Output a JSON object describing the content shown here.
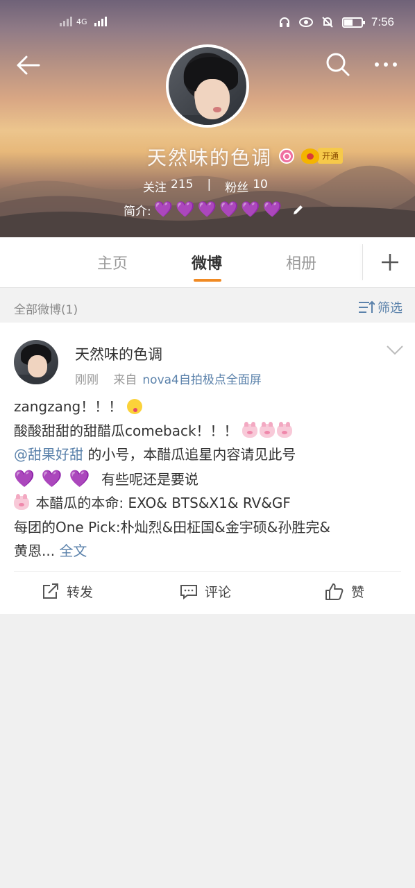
{
  "status_bar": {
    "network": "4G",
    "time": "7:56"
  },
  "profile": {
    "name": "天然味的色调",
    "vip_label": "开通",
    "following_label": "关注",
    "following_count": "215",
    "stat_separator": "|",
    "followers_label": "粉丝",
    "followers_count": "10",
    "bio_label": "简介:",
    "bio_hearts": [
      "💜",
      "💜",
      "💜",
      "💜",
      "💜",
      "💜"
    ]
  },
  "tabs": {
    "home": "主页",
    "weibo": "微博",
    "album": "相册",
    "active": "微博"
  },
  "filter": {
    "label": "全部微博(1)",
    "button": "筛选"
  },
  "post": {
    "author": "天然味的色调",
    "time": "刚刚",
    "source_prefix": "来自",
    "source": "nova4自拍极点全面屏",
    "line1_text": "zangzang！！！",
    "line2_text": "酸酸甜甜的甜醋瓜comeback！！！",
    "line3_mention": "@甜果好甜",
    "line3_text": "的小号，本醋瓜追星内容请见此号",
    "line4_hearts": [
      "💜",
      "💜",
      "💜"
    ],
    "line4_text": "有些呢还是要说",
    "line5_text": "本醋瓜的本命: EXO& BTS&X1& RV&GF",
    "line6_text": "每团的One Pick:朴灿烈&田柾国&金宇硕&孙胜完&",
    "line7_text": "黄恩...",
    "full_text_link": "全文"
  },
  "actions": {
    "repost": "转发",
    "comment": "评论",
    "like": "赞"
  },
  "icons": {
    "back": "back-arrow-icon",
    "search": "search-icon",
    "more": "more-icon",
    "add": "plus-icon",
    "filter": "filter-icon",
    "chevron": "chevron-down-icon"
  },
  "colors": {
    "accent_orange": "#f08a24",
    "link_blue": "#5b82ab",
    "heart_purple": "#7b2bd4"
  }
}
